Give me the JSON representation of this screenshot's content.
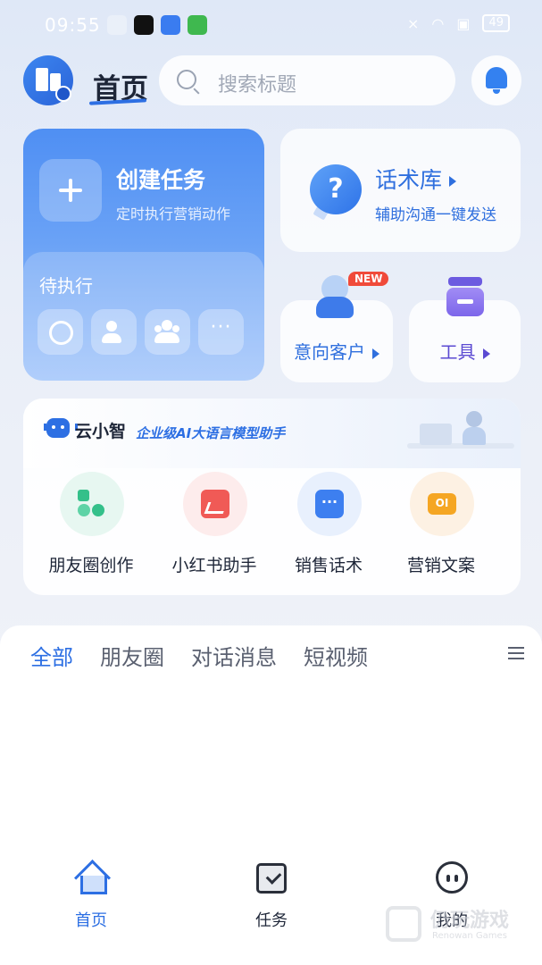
{
  "status_bar": {
    "time": "09:55",
    "battery": "49"
  },
  "header": {
    "title": "首页",
    "search_placeholder": "搜索标题"
  },
  "create_task": {
    "title": "创建任务",
    "subtitle": "定时执行营销动作",
    "pending_label": "待执行",
    "pending_icons": [
      "loading-ring-icon",
      "add-user-icon",
      "group-icon",
      "more-icon"
    ],
    "more_glyph": "···"
  },
  "script_library": {
    "title": "话术库",
    "subtitle": "辅助沟通一键发送"
  },
  "intent_customers": {
    "label": "意向客户",
    "badge": "NEW"
  },
  "tools": {
    "label": "工具"
  },
  "ai_assistant": {
    "name": "云小智",
    "tagline": "企业级AI大语言模型助手",
    "tools": [
      {
        "label": "朋友圈创作",
        "icon": "shapes-icon"
      },
      {
        "label": "小红书助手",
        "icon": "photo-icon"
      },
      {
        "label": "销售话术",
        "icon": "chat-icon"
      },
      {
        "label": "营销文案",
        "icon": "ad-icon"
      }
    ]
  },
  "feed": {
    "tabs": [
      "全部",
      "朋友圈",
      "对话消息",
      "短视频"
    ],
    "active_tab": 0
  },
  "bottom_nav": {
    "items": [
      "首页",
      "任务",
      "我的"
    ],
    "active": 0
  },
  "watermark": {
    "main": "仍玩游戏",
    "sub": "Renowan Games"
  },
  "colors": {
    "accent": "#2d6fe3",
    "card_blue": "#4f8ff3",
    "badge_red": "#f04a3a",
    "tools_purple": "#5b4ad2"
  }
}
